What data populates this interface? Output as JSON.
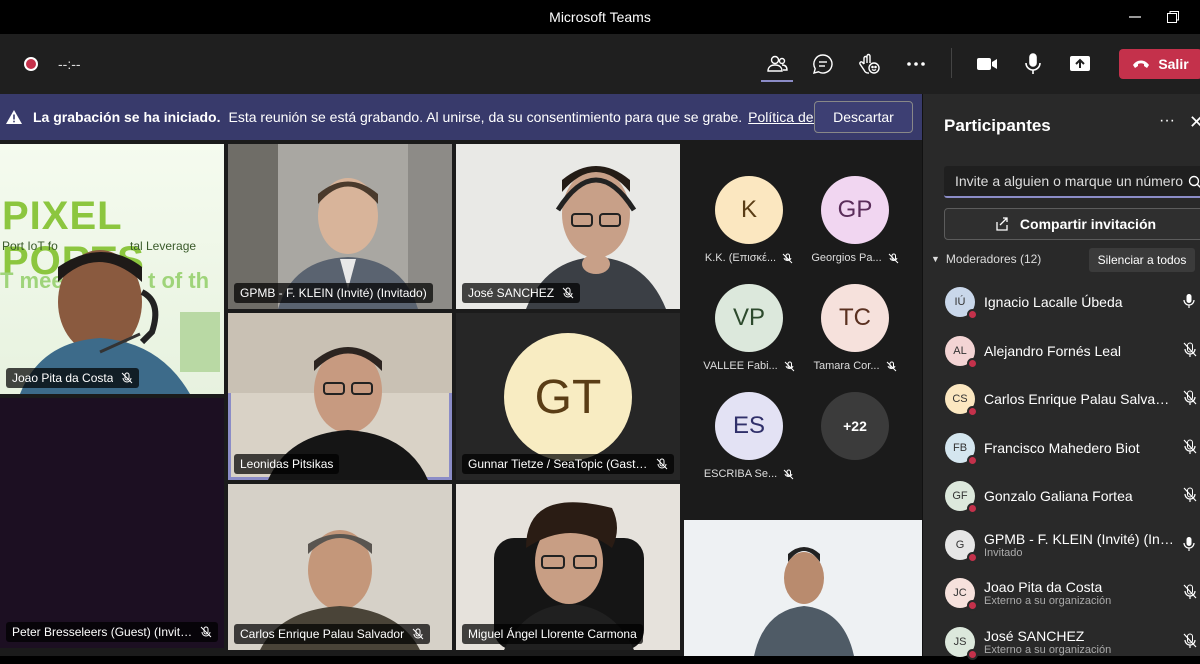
{
  "window": {
    "title": "Microsoft Teams"
  },
  "toolbar": {
    "timer": "--:--",
    "leave_label": "Salir",
    "accent": "#8b8cc7",
    "leave_color": "#c4314b"
  },
  "banner": {
    "bold": "La grabación se ha iniciado.",
    "message": "Esta reunión se está grabando. Al unirse, da su consentimiento para que se grabe.",
    "link": "Política de privacidad",
    "dismiss_label": "Descartar"
  },
  "tiles": [
    {
      "name": "Joao Pita da Costa",
      "bg_text": [
        "PIXEL PORTS",
        "Port IoT fo",
        "tal Leverage",
        "T mee",
        "t of th"
      ]
    },
    {
      "name": "GPMB - F. KLEIN (Invité) (Invitado)"
    },
    {
      "name": "José SANCHEZ"
    },
    {
      "name": "Leonidas Pitsikas"
    },
    {
      "name": "Gunnar Tietze / SeaTopic (Gast)...",
      "initials": "GT"
    },
    {
      "name": "Peter Bresseleers (Guest) (Invita..."
    },
    {
      "name": "Carlos Enrique Palau Salvador"
    },
    {
      "name": "Miguel Ángel Llorente Carmona"
    },
    {
      "name": ""
    }
  ],
  "avatars": [
    {
      "initials": "K",
      "name": "K.K. (Επισκέ...",
      "color": "#fbe7c0"
    },
    {
      "initials": "GP",
      "name": "Georgios Pa...",
      "color": "#f1d6f1"
    },
    {
      "initials": "VP",
      "name": "VALLEE Fabi...",
      "color": "#dce8dc"
    },
    {
      "initials": "TC",
      "name": "Tamara Cor...",
      "color": "#f6e1dc"
    },
    {
      "initials": "ES",
      "name": "ESCRIBA Se...",
      "color": "#e3e2f4"
    },
    {
      "initials": "+22",
      "name": "",
      "color": "#3b3b3b"
    }
  ],
  "panel": {
    "title": "Participantes",
    "search_placeholder": "Invite a alguien o marque un número",
    "share_label": "Compartir invitación",
    "moderators_label": "Moderadores (12)",
    "mute_all_label": "Silenciar a todos",
    "participants": [
      {
        "initials": "IÚ",
        "name": "Ignacio Lacalle Úbeda",
        "sub": "",
        "color": "#c9d7ea",
        "mic": "on"
      },
      {
        "initials": "AL",
        "name": "Alejandro Fornés Leal",
        "sub": "",
        "color": "#f3d4d4",
        "mic": "off"
      },
      {
        "initials": "CS",
        "name": "Carlos Enrique Palau Salvador",
        "sub": "",
        "color": "#fbe7c0",
        "mic": "off"
      },
      {
        "initials": "FB",
        "name": "Francisco Mahedero Biot",
        "sub": "",
        "color": "#d4e6ef",
        "mic": "off"
      },
      {
        "initials": "GF",
        "name": "Gonzalo Galiana Fortea",
        "sub": "",
        "color": "#dce8dc",
        "mic": "off"
      },
      {
        "initials": "G",
        "name": "GPMB - F. KLEIN (Invité) (Invitado)",
        "sub": "Invitado",
        "color": "#e6e6e6",
        "mic": "on"
      },
      {
        "initials": "JC",
        "name": "Joao Pita da Costa",
        "sub": "Externo a su organización",
        "color": "#f6e1dc",
        "mic": "off"
      },
      {
        "initials": "JS",
        "name": "José SANCHEZ",
        "sub": "Externo a su organización",
        "color": "#dce8dc",
        "mic": "off"
      }
    ]
  }
}
